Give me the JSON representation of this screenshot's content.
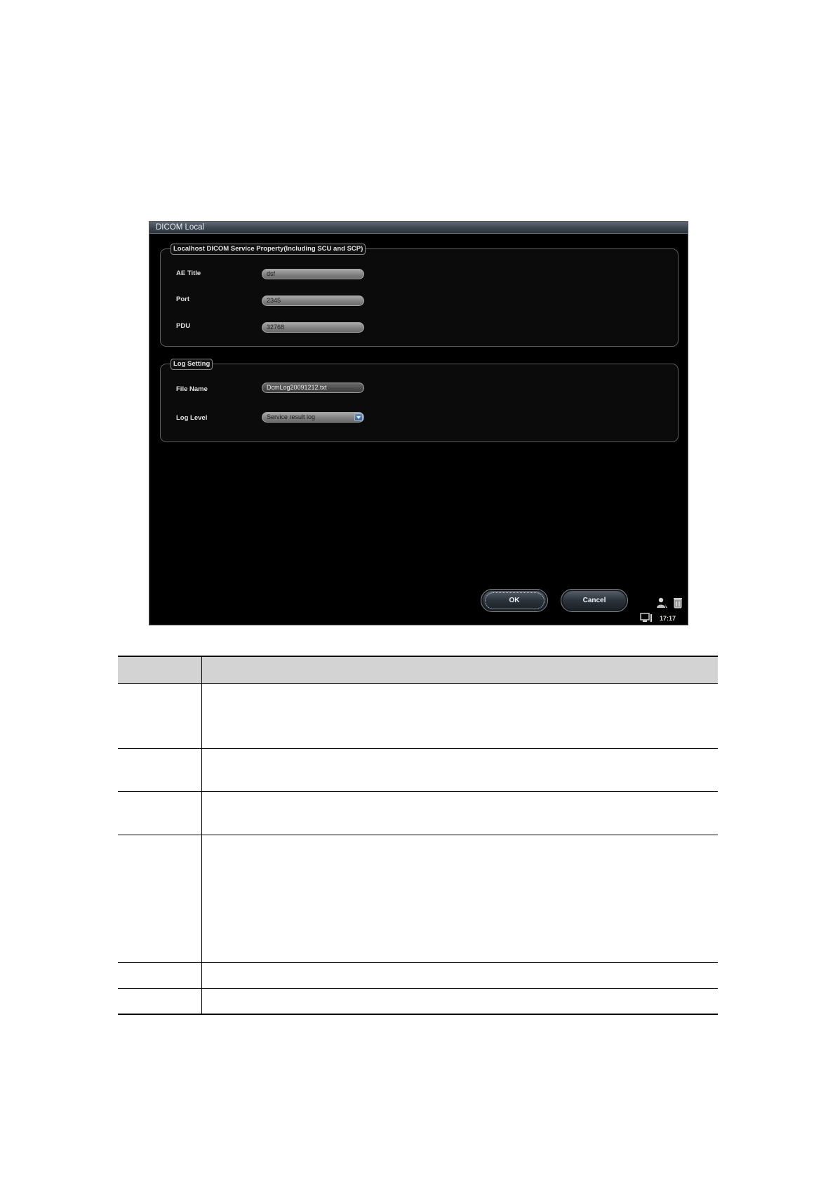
{
  "window": {
    "title": "DICOM Local"
  },
  "localhost_group": {
    "legend": "Localhost DICOM Service Property(Including SCU and SCP)",
    "fields": [
      {
        "label": "AE Title",
        "value": "dsf"
      },
      {
        "label": "Port",
        "value": "2345"
      },
      {
        "label": "PDU",
        "value": "32768"
      }
    ]
  },
  "log_group": {
    "legend": "Log Setting",
    "file_name": {
      "label": "File Name",
      "value": "DcmLog20091212.txt"
    },
    "log_level": {
      "label": "Log Level",
      "value": "Service result log"
    }
  },
  "buttons": {
    "ok": "OK",
    "cancel": "Cancel"
  },
  "status_tray": {
    "icons": [
      "user-icon",
      "trash-icon",
      "monitor-icon"
    ],
    "time": "17:17"
  },
  "doc_table": {
    "header": [
      "",
      ""
    ],
    "rows": [
      [
        "",
        ""
      ],
      [
        "",
        ""
      ],
      [
        "",
        ""
      ],
      [
        "",
        ""
      ],
      [
        "",
        ""
      ],
      [
        "",
        ""
      ]
    ]
  },
  "colors": {
    "window_bg": "#000000",
    "titlebar": "#3d4650",
    "table_header_bg": "#d3d3d3"
  }
}
